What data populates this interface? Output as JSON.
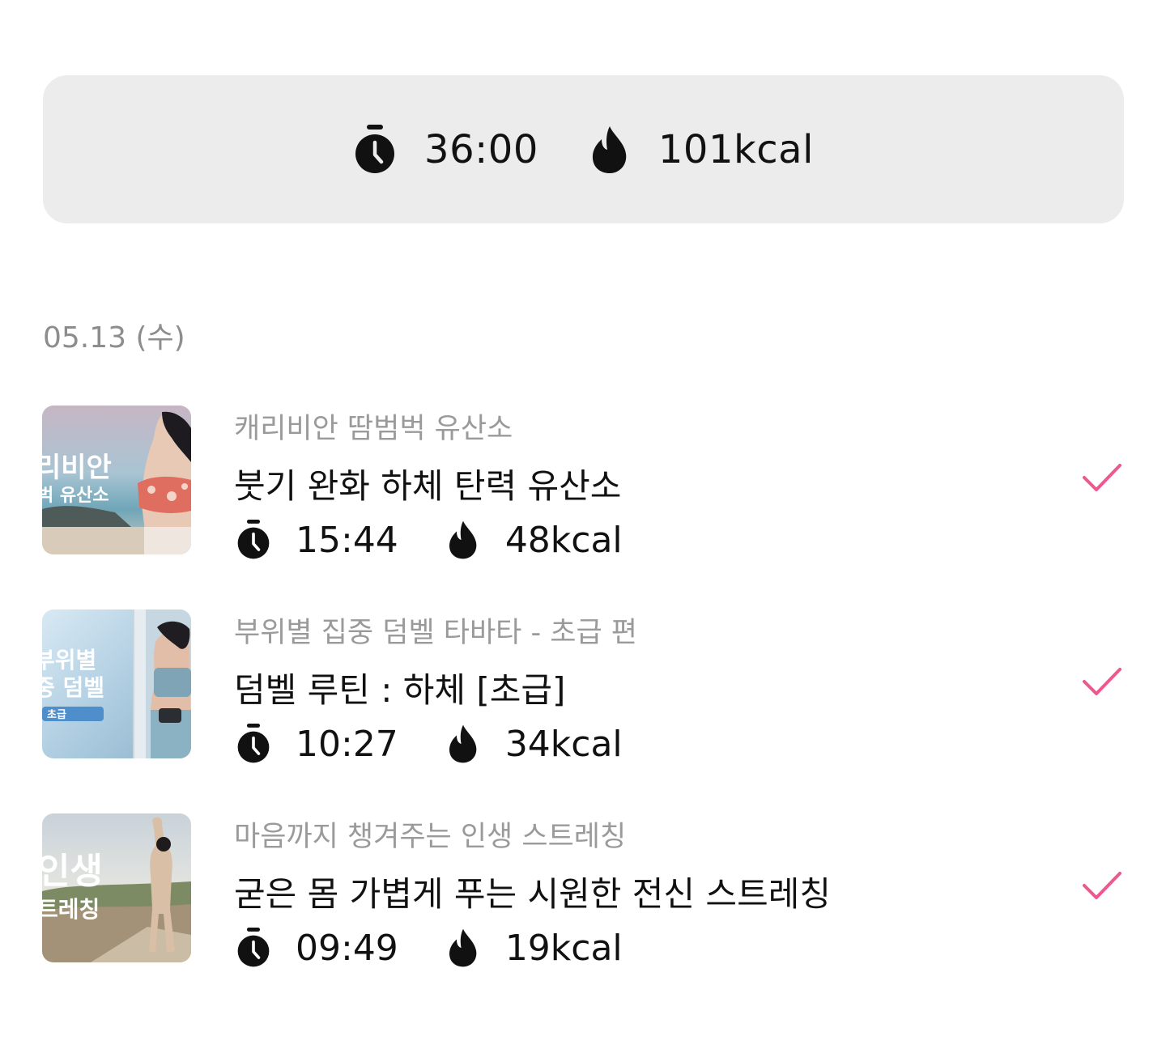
{
  "summary": {
    "duration": "36:00",
    "calories": "101kcal",
    "duration_icon": "stopwatch-icon",
    "calories_icon": "flame-icon"
  },
  "date_label": "05.13 (수)",
  "colors": {
    "accent": "#f0568f",
    "summary_bg": "#ececec",
    "muted_text": "#9a9a9a"
  },
  "workouts": [
    {
      "series": "캐리비안 땀범벅 유산소",
      "title": "붓기 완화 하체 탄력 유산소",
      "duration": "15:44",
      "calories": "48kcal",
      "completed": true,
      "thumb_text": [
        "리비안",
        "벅 유산소"
      ]
    },
    {
      "series": "부위별 집중 덤벨 타바타 - 초급 편",
      "title": "덤벨 루틴 : 하체 [초급]",
      "duration": "10:27",
      "calories": "34kcal",
      "completed": true,
      "thumb_text": [
        "부위별",
        "중 덤벨",
        "초급"
      ]
    },
    {
      "series": "마음까지 챙겨주는 인생 스트레칭",
      "title": "굳은 몸 가볍게 푸는 시원한 전신 스트레칭",
      "duration": "09:49",
      "calories": "19kcal",
      "completed": true,
      "thumb_text": [
        "인생",
        "트레칭"
      ]
    }
  ]
}
